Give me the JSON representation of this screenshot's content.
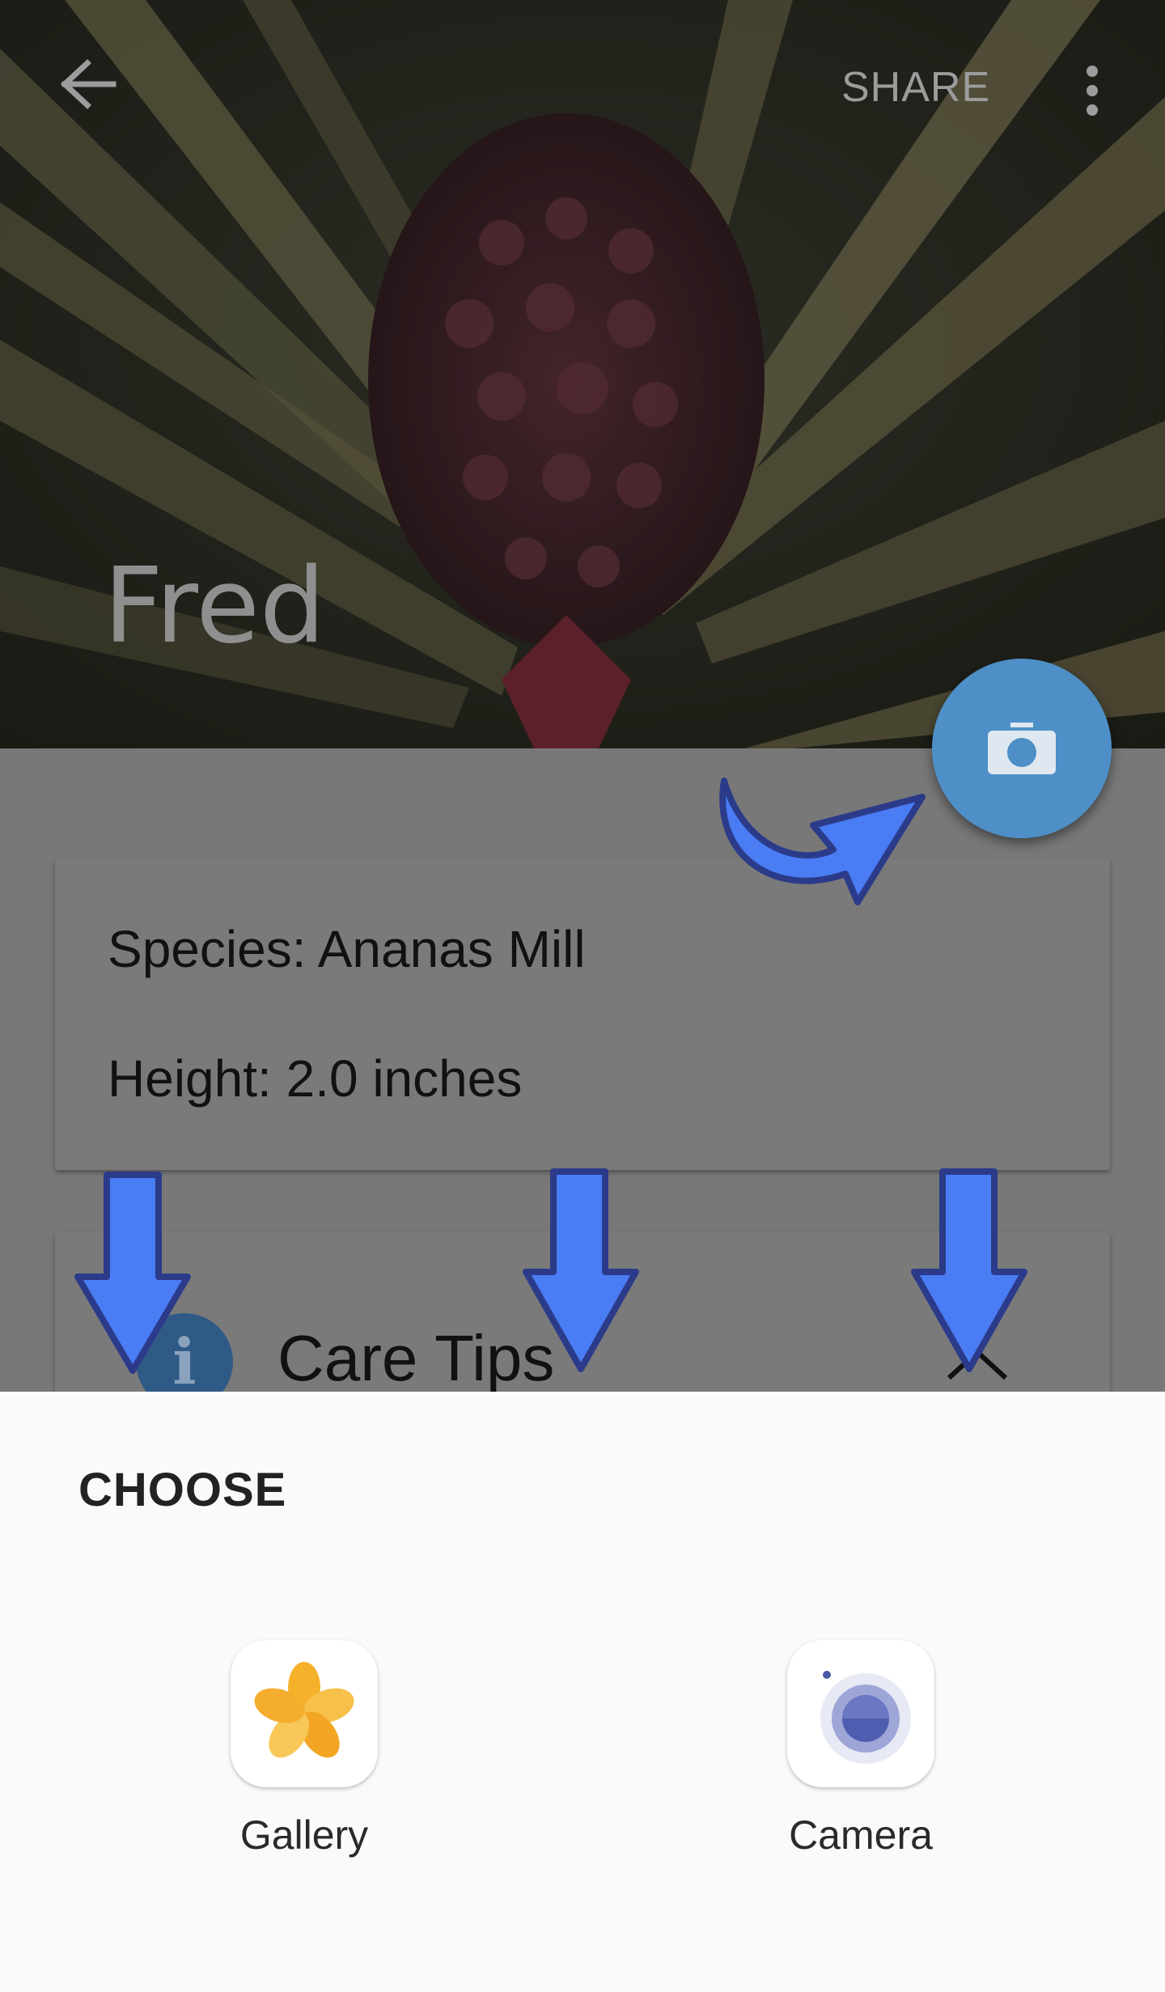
{
  "toolbar": {
    "back_icon": "arrow-back-icon",
    "share_label": "SHARE",
    "overflow_icon": "more-vert-icon"
  },
  "plant": {
    "name": "Fred",
    "species": "Species: Ananas Mill",
    "height": "Height: 2.0 inches"
  },
  "care": {
    "title": "Care Tips",
    "icon": "info-icon",
    "info_glyph": "i",
    "expand_icon": "chevron-up-icon"
  },
  "fab": {
    "icon": "camera-icon",
    "color": "#4d8fc6"
  },
  "sheet": {
    "title": "CHOOSE",
    "options": [
      {
        "label": "Gallery",
        "icon": "gallery-flower-icon"
      },
      {
        "label": "Camera",
        "icon": "camera-lens-icon"
      }
    ]
  },
  "annotation_color": "#4a7cf4"
}
